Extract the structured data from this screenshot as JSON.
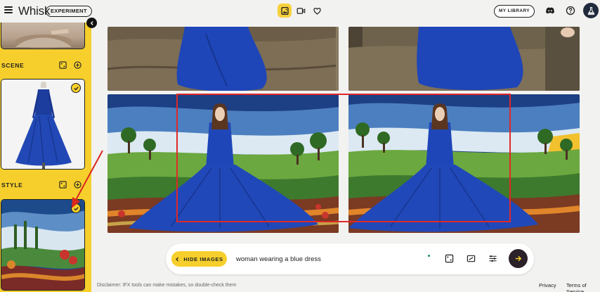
{
  "header": {
    "app_name": "Whisk",
    "badge": "EXPERIMENT",
    "library_label": "MY LIBRARY"
  },
  "icons": {
    "menu": "menu-icon",
    "image_mode": "image-icon",
    "video_mode": "video-icon",
    "favorites": "heart-icon",
    "discord": "discord-icon",
    "help": "help-icon",
    "account": "flask-icon"
  },
  "sidebar": {
    "scene_label": "SCENE",
    "style_label": "STYLE"
  },
  "prompt": {
    "hide_label": "HIDE IMAGES",
    "text": "woman wearing a blue dress"
  },
  "footer": {
    "disclaimer": "Disclaimer: IFX tools can make mistakes, so double-check them",
    "privacy": "Privacy",
    "terms": "Terms of Service"
  },
  "colors": {
    "accent": "#f6cf2c",
    "dress": "#1e3fa8",
    "highlight_frame": "#e02828",
    "send_button": "#2b2128"
  }
}
